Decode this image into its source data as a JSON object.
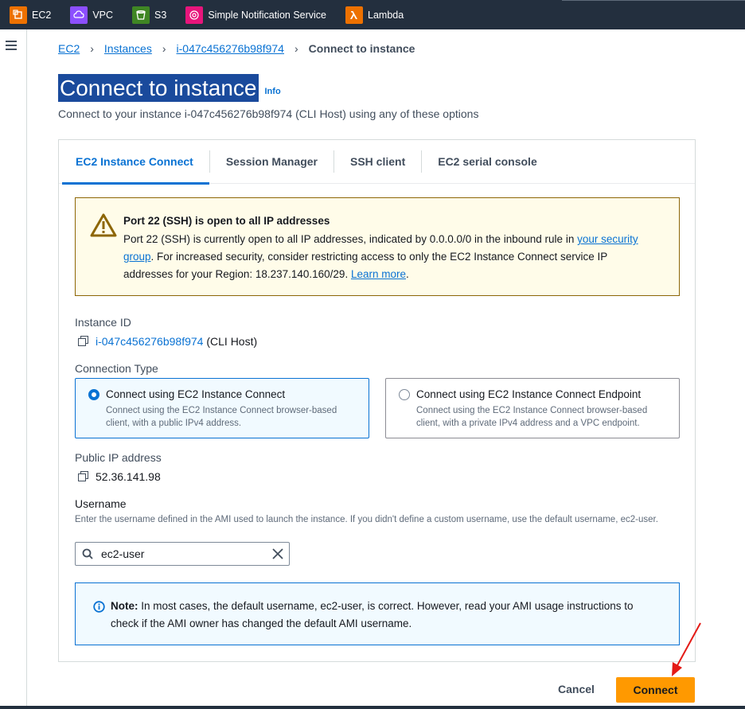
{
  "topbar": {
    "services": [
      {
        "label": "EC2",
        "color": "#ed7100",
        "icon": "ec2-icon"
      },
      {
        "label": "VPC",
        "color": "#8c4fff",
        "icon": "vpc-icon"
      },
      {
        "label": "S3",
        "color": "#3f8624",
        "icon": "s3-icon"
      },
      {
        "label": "Simple Notification Service",
        "color": "#e7157b",
        "icon": "sns-icon"
      },
      {
        "label": "Lambda",
        "color": "#ed7100",
        "icon": "lambda-icon"
      }
    ]
  },
  "breadcrumb": {
    "items": [
      "EC2",
      "Instances",
      "i-047c456276b98f974"
    ],
    "current": "Connect to instance"
  },
  "page": {
    "title": "Connect to instance",
    "info": "Info",
    "subtitle": "Connect to your instance i-047c456276b98f974 (CLI Host) using any of these options"
  },
  "tabs": [
    "EC2 Instance Connect",
    "Session Manager",
    "SSH client",
    "EC2 serial console"
  ],
  "warning": {
    "title": "Port 22 (SSH) is open to all IP addresses",
    "body_1": "Port 22 (SSH) is currently open to all IP addresses, indicated by 0.0.0.0/0 in the inbound rule in ",
    "link_1": "your security group",
    "body_2": ". For increased security, consider restricting access to only the EC2 Instance Connect service IP addresses for your Region: 18.237.140.160/29. ",
    "link_2": "Learn more",
    "body_3": "."
  },
  "instance": {
    "label": "Instance ID",
    "id": "i-047c456276b98f974",
    "name": " (CLI Host)"
  },
  "connection_type": {
    "label": "Connection Type",
    "options": [
      {
        "title": "Connect using EC2 Instance Connect",
        "desc": "Connect using the EC2 Instance Connect browser-based client, with a public IPv4 address.",
        "selected": true
      },
      {
        "title": "Connect using EC2 Instance Connect Endpoint",
        "desc": "Connect using the EC2 Instance Connect browser-based client, with a private IPv4 address and a VPC endpoint.",
        "selected": false
      }
    ]
  },
  "public_ip": {
    "label": "Public IP address",
    "value": "52.36.141.98"
  },
  "username": {
    "label": "Username",
    "hint": "Enter the username defined in the AMI used to launch the instance. If you didn't define a custom username, use the default username, ec2-user.",
    "value": "ec2-user"
  },
  "note": {
    "bold": "Note:",
    "text": " In most cases, the default username, ec2-user, is correct. However, read your AMI usage instructions to check if the AMI owner has changed the default AMI username."
  },
  "footer": {
    "cancel": "Cancel",
    "connect": "Connect"
  },
  "colors": {
    "accent": "#0972d3",
    "primary_button": "#ff9900",
    "warning_bg": "#fffce9",
    "annotation_arrow": "#e41b17"
  }
}
